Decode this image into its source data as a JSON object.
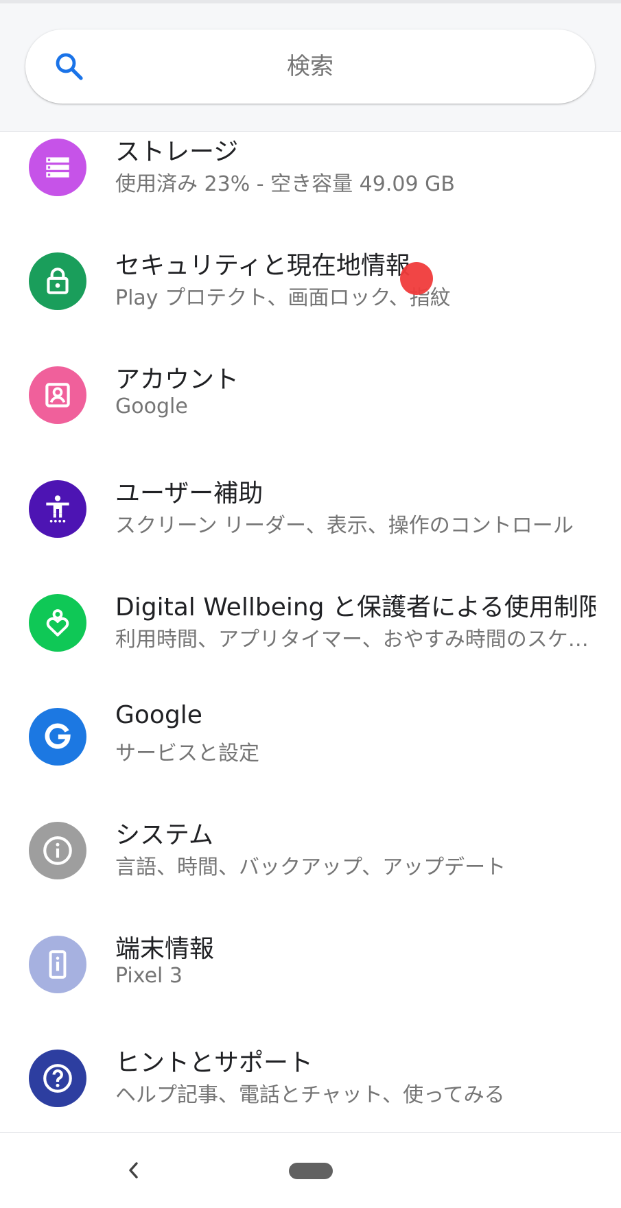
{
  "search": {
    "placeholder": "検索"
  },
  "colors": {
    "storage": "#c653e8",
    "security": "#1a9e5b",
    "accounts": "#f0609b",
    "accessibility": "#4d14b3",
    "wellbeing": "#0fc856",
    "google": "#1c78e2",
    "system": "#9e9e9e",
    "about": "#a6b1e0",
    "tips": "#2d3ea0"
  },
  "settings": {
    "items": [
      {
        "icon": "storage-icon",
        "title": "ストレージ",
        "subtitle": "使用済み 23% - 空き容量 49.09 GB"
      },
      {
        "icon": "lock-icon",
        "title": "セキュリティと現在地情報",
        "subtitle": "Play プロテクト、画面ロック、指紋"
      },
      {
        "icon": "account-icon",
        "title": "アカウント",
        "subtitle": "Google"
      },
      {
        "icon": "accessibility-icon",
        "title": "ユーザー補助",
        "subtitle": "スクリーン リーダー、表示、操作のコントロール"
      },
      {
        "icon": "wellbeing-heart-icon",
        "title": "Digital Wellbeing と保護者による使用制限",
        "subtitle": "利用時間、アプリタイマー、おやすみ時間のスケジュール"
      },
      {
        "icon": "google-g-icon",
        "title": "Google",
        "subtitle": "サービスと設定"
      },
      {
        "icon": "info-icon",
        "title": "システム",
        "subtitle": "言語、時間、バックアップ、アップデート"
      },
      {
        "icon": "phone-info-icon",
        "title": "端末情報",
        "subtitle": "Pixel 3"
      },
      {
        "icon": "help-icon",
        "title": "ヒントとサポート",
        "subtitle": "ヘルプ記事、電話とチャット、使ってみる"
      }
    ]
  },
  "navigation": {
    "back": "chevron-left-icon",
    "home": "home-pill-icon"
  }
}
